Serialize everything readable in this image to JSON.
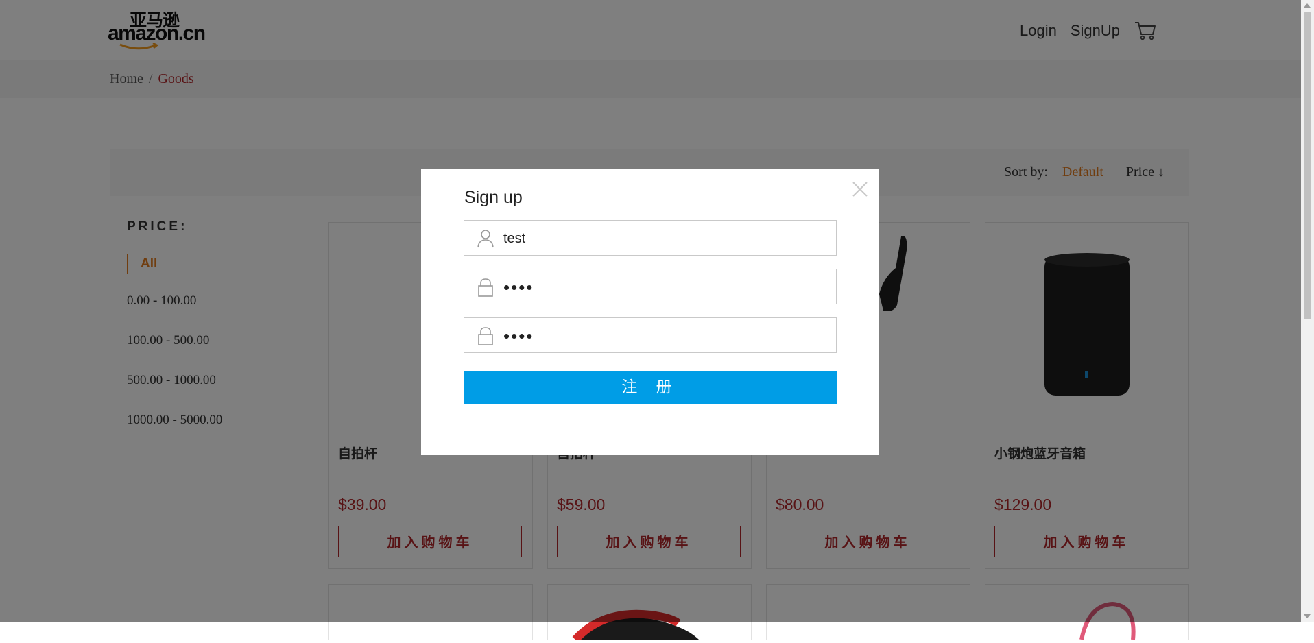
{
  "header": {
    "logo_cn": "亚马逊",
    "logo_en": "amazon.cn",
    "nav": {
      "login": "Login",
      "signup": "SignUp"
    }
  },
  "breadcrumb": {
    "home": "Home",
    "sep": "/",
    "current": "Goods"
  },
  "sort": {
    "label": "Sort by:",
    "default": "Default",
    "price": "Price ↓"
  },
  "sidebar": {
    "title": "PRICE:",
    "items": [
      {
        "label": "All"
      },
      {
        "label": "0.00 - 100.00"
      },
      {
        "label": "100.00 - 500.00"
      },
      {
        "label": "500.00 - 1000.00"
      },
      {
        "label": "1000.00 - 5000.00"
      }
    ]
  },
  "products": [
    {
      "name": "自拍杆",
      "price": "$39.00",
      "button": "加入购物车"
    },
    {
      "name": "自拍杆",
      "price": "$59.00",
      "button": "加入购物车"
    },
    {
      "name": "",
      "price": "$80.00",
      "button": "加入购物车"
    },
    {
      "name": "小钢炮蓝牙音箱",
      "price": "$129.00",
      "button": "加入购物车"
    }
  ],
  "modal": {
    "title": "Sign up",
    "username_value": "test",
    "password_value": "test",
    "confirm_value": "test",
    "submit_label": "注 册"
  },
  "colors": {
    "accent_red": "#b0262a",
    "accent_orange": "#e07a1f",
    "button_blue": "#009de6",
    "overlay": "rgba(0,0,0,0.5)"
  }
}
